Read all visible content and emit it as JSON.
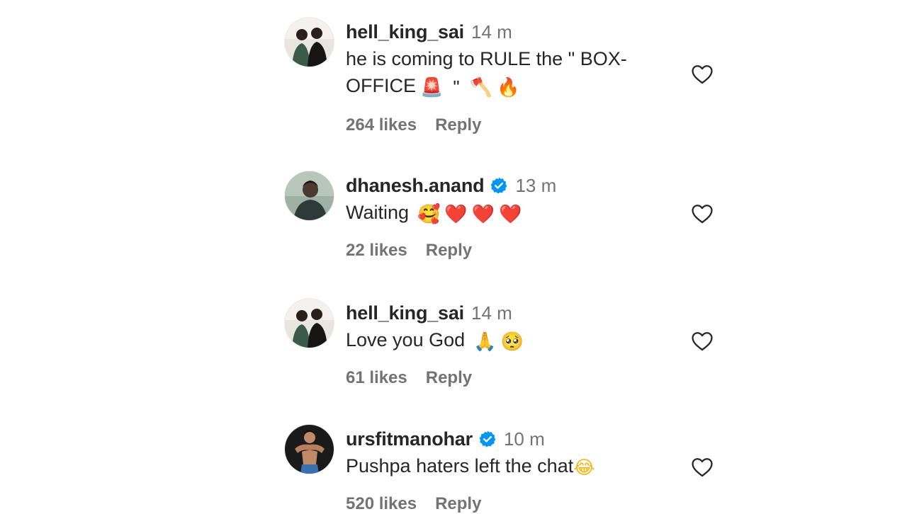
{
  "comments": [
    {
      "username": "hell_king_sai",
      "verified": false,
      "time": "14 m",
      "text": "he is coming to RULE the \" BOX-OFFICE",
      "emojis": [
        "🚨",
        "\"",
        "🪓",
        "🔥"
      ],
      "likes": "264 likes",
      "reply": "Reply"
    },
    {
      "username": "dhanesh.anand",
      "verified": true,
      "time": "13 m",
      "text": "Waiting",
      "emojis": [
        "🥰",
        "❤️",
        "❤️",
        "❤️"
      ],
      "likes": "22 likes",
      "reply": "Reply"
    },
    {
      "username": "hell_king_sai",
      "verified": false,
      "time": "14 m",
      "text": "Love you God",
      "emojis": [
        "🙏",
        "🥺"
      ],
      "likes": "61 likes",
      "reply": "Reply"
    },
    {
      "username": "ursfitmanohar",
      "verified": true,
      "time": "10 m",
      "text": "Pushpa haters left the chat",
      "emojis": [
        "😂"
      ],
      "likes": "520 likes",
      "reply": "Reply"
    }
  ],
  "colors": {
    "username": "#262626",
    "secondary": "#737373",
    "verified": "#0095f6",
    "heart_outline": "#262626"
  },
  "icons": {
    "like": "heart-outline-icon",
    "verified": "verified-badge-icon"
  }
}
